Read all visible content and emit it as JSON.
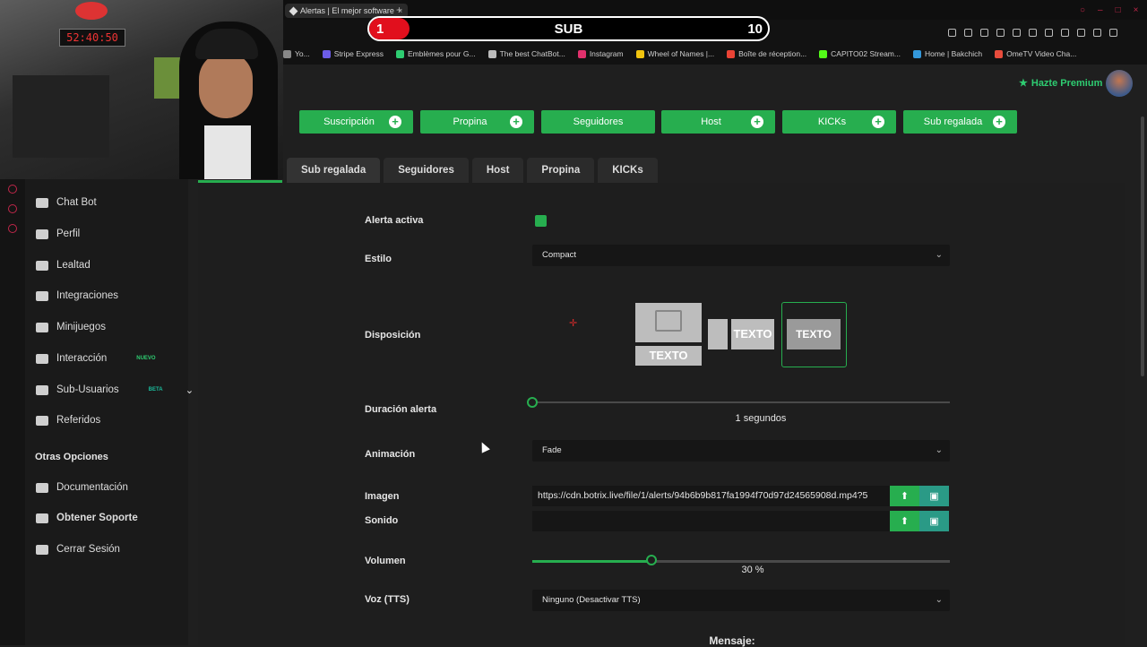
{
  "browser": {
    "tab_title": "Alertas | El mejor software",
    "bookmarks": [
      {
        "label": "Yo...",
        "color": "#888888"
      },
      {
        "label": "Stripe Express",
        "color": "#6c5ce7"
      },
      {
        "label": "Emblèmes pour G...",
        "color": "#2ecc71"
      },
      {
        "label": "The best ChatBot...",
        "color": "#bbbbbb"
      },
      {
        "label": "Instagram",
        "color": "#e1306c"
      },
      {
        "label": "Wheel of Names |...",
        "color": "#f1c40f"
      },
      {
        "label": "Boîte de réception...",
        "color": "#ea4335"
      },
      {
        "label": "CAPITO02 Stream...",
        "color": "#53fc18"
      },
      {
        "label": "Home | Bakchich",
        "color": "#3498db"
      },
      {
        "label": "OmeTV Video Cha...",
        "color": "#e74c3c"
      }
    ]
  },
  "overlay": {
    "left_score": "1",
    "center_label": "SUB",
    "right_score": "10",
    "left_fill_percent": 10
  },
  "header": {
    "premium_label": "Hazte Premium"
  },
  "alert_buttons": [
    {
      "label": "Suscripción",
      "plus": true
    },
    {
      "label": "Propina",
      "plus": true
    },
    {
      "label": "Seguidores",
      "plus": false
    },
    {
      "label": "Host",
      "plus": true
    },
    {
      "label": "KICKs",
      "plus": true
    },
    {
      "label": "Sub regalada",
      "plus": true
    }
  ],
  "sub_tabs": [
    "Sub regalada",
    "Seguidores",
    "Host",
    "Propina",
    "KICKs"
  ],
  "sidebar": {
    "items": [
      {
        "label": "Chat Bot"
      },
      {
        "label": "Perfil"
      },
      {
        "label": "Lealtad"
      },
      {
        "label": "Integraciones"
      },
      {
        "label": "Minijuegos"
      },
      {
        "label": "Interacción",
        "badge": "NUEVO",
        "badge_color": "#2ecc71"
      },
      {
        "label": "Sub-Usuarios",
        "badge": "BETA",
        "badge_color": "#1abc9c"
      },
      {
        "label": "Referidos"
      }
    ],
    "section_title": "Otras Opciones",
    "other_items": [
      {
        "label": "Documentación"
      },
      {
        "label": "Obtener Soporte"
      },
      {
        "label": "Cerrar Sesión"
      }
    ]
  },
  "form": {
    "alerta_activa_label": "Alerta activa",
    "alerta_activa_checked": true,
    "estilo_label": "Estilo",
    "estilo_value": "Compact",
    "disposicion_label": "Disposición",
    "layout_text": "TEXTO",
    "duracion_label": "Duración alerta",
    "duracion_value": "1 segundos",
    "animacion_label": "Animación",
    "animacion_value": "Fade",
    "imagen_label": "Imagen",
    "imagen_value": "https://cdn.botrix.live/file/1/alerts/94b6b9b817fa1994f70d97d24565908d.mp4?5",
    "sonido_label": "Sonido",
    "sonido_value": "",
    "volumen_label": "Volumen",
    "volumen_value": "30 %",
    "volumen_fraction": 0.3,
    "voz_label": "Voz (TTS)",
    "voz_value": "Ninguno (Desactivar TTS)",
    "mensaje_label": "Mensaje:"
  },
  "colors": {
    "accent": "#27ae4f",
    "live_red": "#e10f1d"
  }
}
